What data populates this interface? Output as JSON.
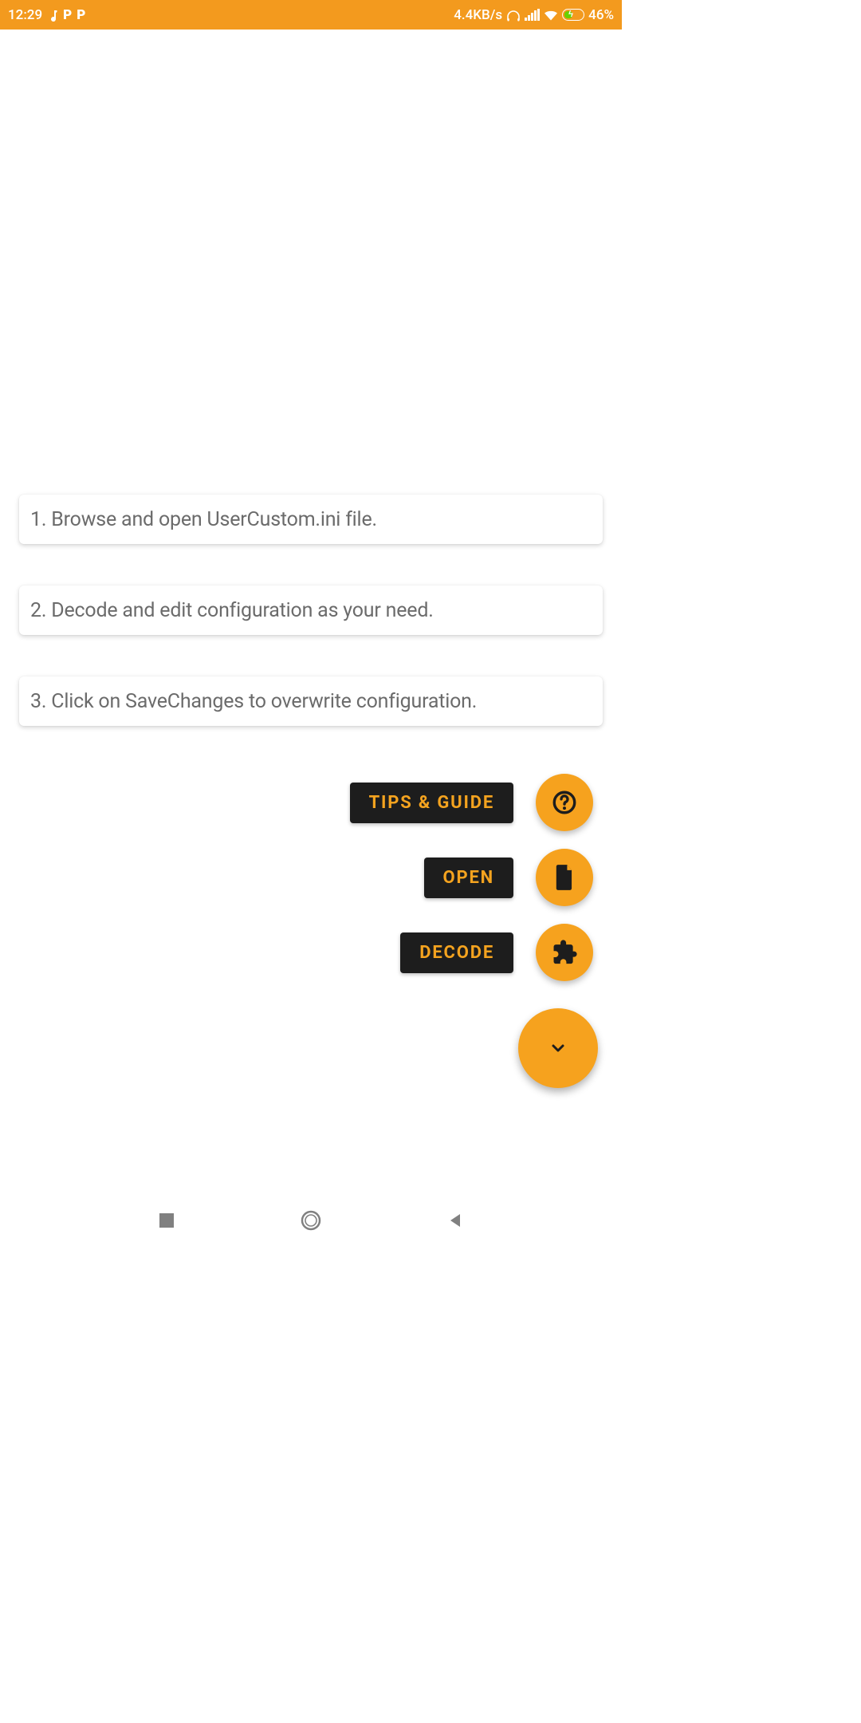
{
  "status": {
    "time": "12:29",
    "net_speed": "4.4KB/s",
    "battery": "46%"
  },
  "cards": {
    "step1": "1. Browse and open UserCustom.ini file.",
    "step2": "2. Decode and edit configuration as your need.",
    "step3": "3. Click on SaveChanges to overwrite configuration."
  },
  "fab": {
    "tips": "TIPS & GUIDE",
    "open": "OPEN",
    "decode": "DECODE"
  }
}
